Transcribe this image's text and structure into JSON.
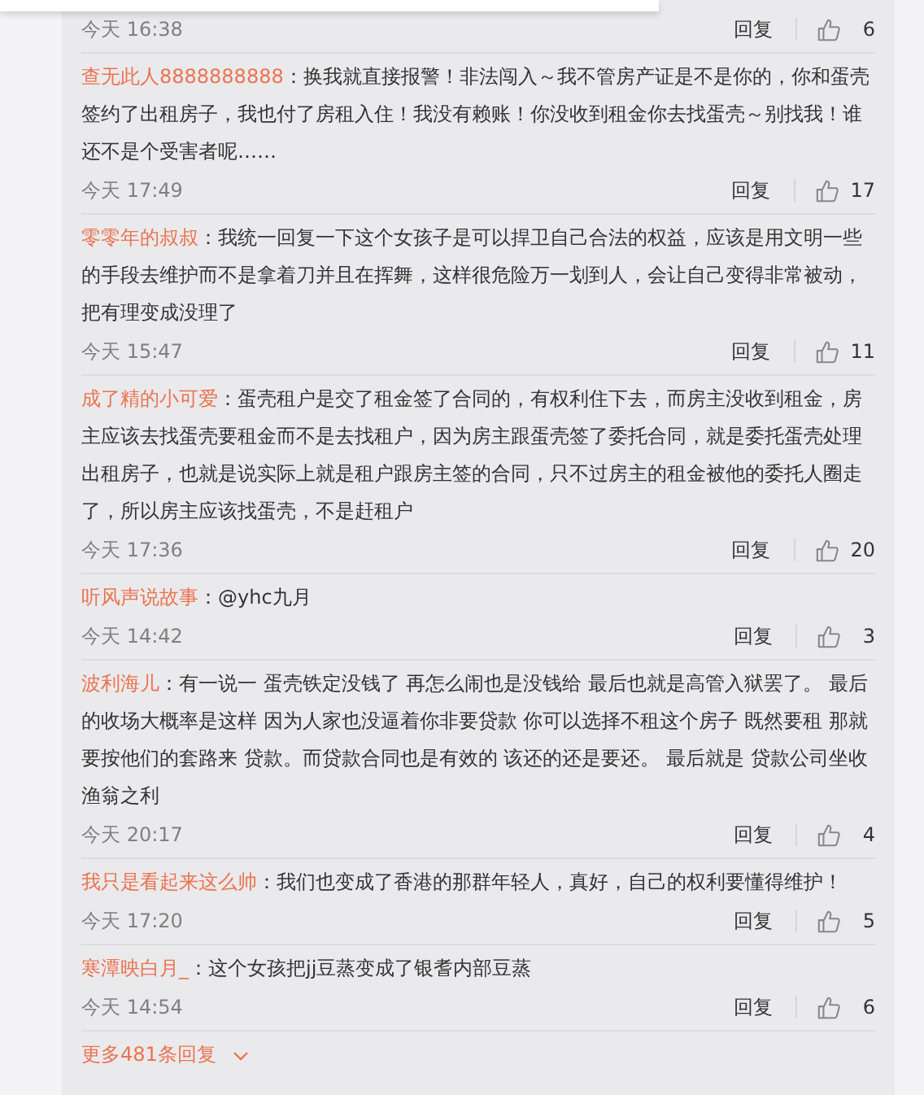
{
  "first_item": {
    "time": "今天 16:38",
    "reply": "回复",
    "likes": "6"
  },
  "comments": [
    {
      "user": "查无此人8888888888",
      "text": "：换我就直接报警！非法闯入～我不管房产证是不是你的，你和蛋壳签约了出租房子，我也付了房租入住！我没有赖账！你没收到租金你去找蛋壳～别找我！谁还不是个受害者呢……",
      "time": "今天 17:49",
      "reply": "回复",
      "likes": "17"
    },
    {
      "user": "零零年的叔叔",
      "text": "：我统一回复一下这个女孩子是可以捍卫自己合法的权益，应该是用文明一些的手段去维护而不是拿着刀并且在挥舞，这样很危险万一划到人，会让自己变得非常被动，把有理变成没理了",
      "time": "今天 15:47",
      "reply": "回复",
      "likes": "11"
    },
    {
      "user": "成了精的小可爱",
      "text": "：蛋壳租户是交了租金签了合同的，有权利住下去，而房主没收到租金，房主应该去找蛋壳要租金而不是去找租户，因为房主跟蛋壳签了委托合同，就是委托蛋壳处理出租房子，也就是说实际上就是租户跟房主签的合同，只不过房主的租金被他的委托人圈走了，所以房主应该找蛋壳，不是赶租户",
      "time": "今天 17:36",
      "reply": "回复",
      "likes": "20"
    },
    {
      "user": "听风声说故事",
      "text": "：@yhc九月",
      "time": "今天 14:42",
      "reply": "回复",
      "likes": "3"
    },
    {
      "user": "波利海儿",
      "text": "：有一说一 蛋壳铁定没钱了 再怎么闹也是没钱给 最后也就是高管入狱罢了。 最后的收场大概率是这样  因为人家也没逼着你非要贷款 你可以选择不租这个房子 既然要租 那就要按他们的套路来 贷款。而贷款合同也是有效的 该还的还是要还。 最后就是 贷款公司坐收渔翁之利",
      "time": "今天 20:17",
      "reply": "回复",
      "likes": "4"
    },
    {
      "user": "我只是看起来这么帅",
      "text": "：我们也变成了香港的那群年轻人，真好，自己的权利要懂得维护！",
      "time": "今天 17:20",
      "reply": "回复",
      "likes": "5"
    },
    {
      "user": "寒潭映白月_",
      "text": "：这个女孩把jj豆蒸变成了银耆内部豆蒸",
      "time": "今天 14:54",
      "reply": "回复",
      "likes": "6"
    }
  ],
  "more_replies": {
    "label": "更多481条回复"
  }
}
